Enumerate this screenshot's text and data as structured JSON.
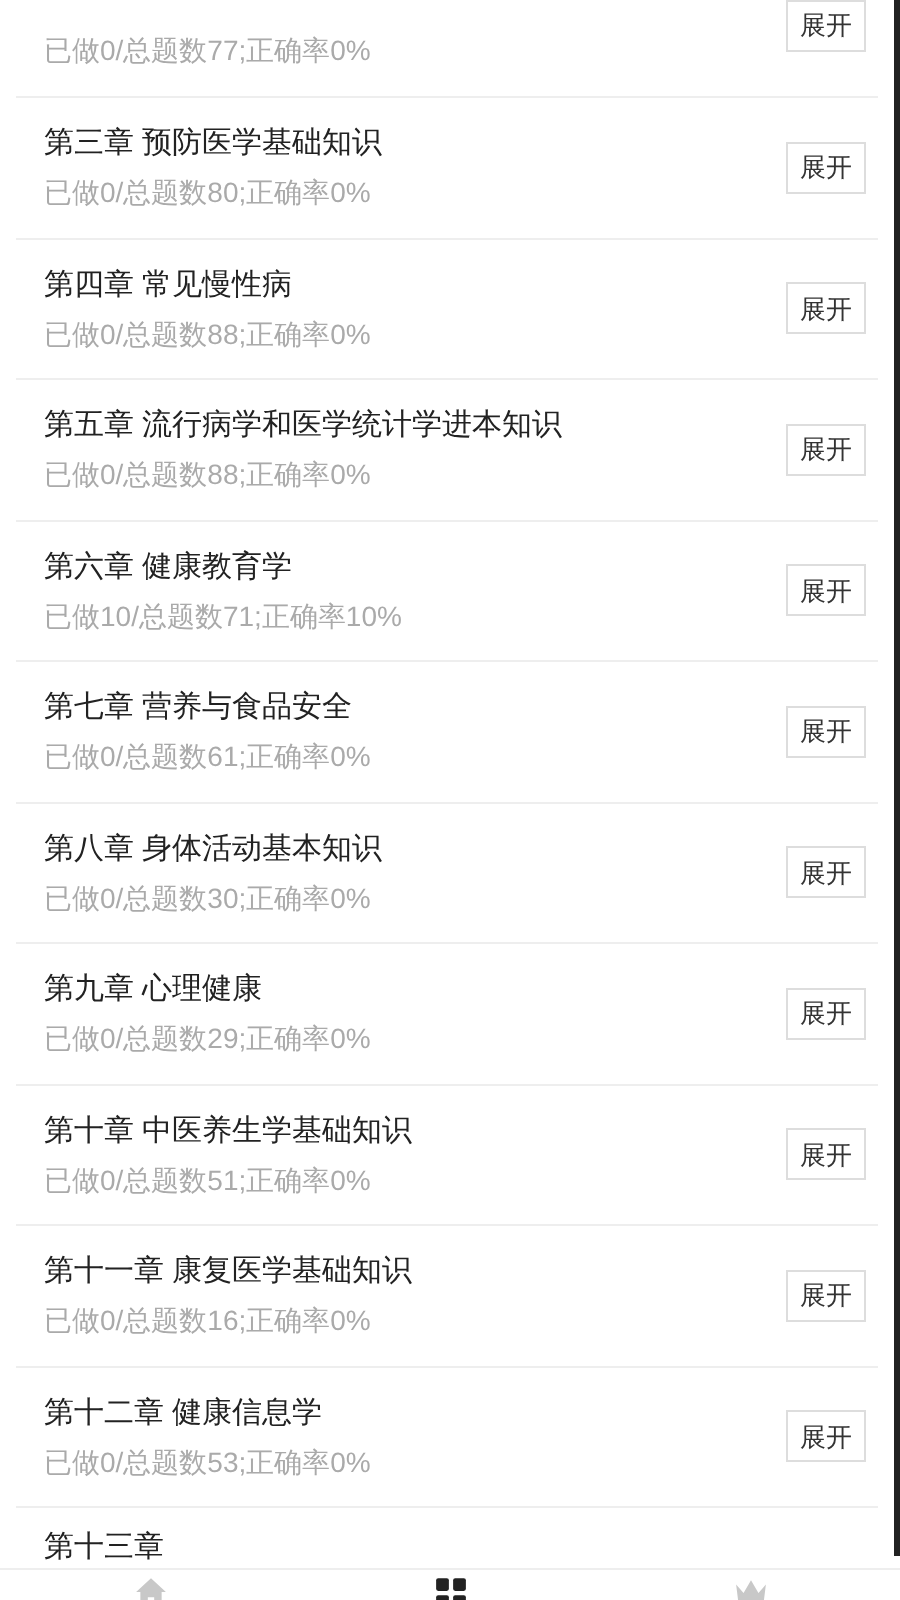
{
  "chapters": [
    {
      "stats": "已做0/总题数77;正确率0%",
      "button": "展开"
    },
    {
      "title": "第三章 预防医学基础知识",
      "stats": "已做0/总题数80;正确率0%",
      "button": "展开"
    },
    {
      "title": "第四章 常见慢性病",
      "stats": "已做0/总题数88;正确率0%",
      "button": "展开"
    },
    {
      "title": "第五章 流行病学和医学统计学进本知识",
      "stats": "已做0/总题数88;正确率0%",
      "button": "展开"
    },
    {
      "title": "第六章 健康教育学",
      "stats": "已做10/总题数71;正确率10%",
      "button": "展开"
    },
    {
      "title": "第七章 营养与食品安全",
      "stats": "已做0/总题数61;正确率0%",
      "button": "展开"
    },
    {
      "title": "第八章 身体活动基本知识",
      "stats": "已做0/总题数30;正确率0%",
      "button": "展开"
    },
    {
      "title": "第九章 心理健康",
      "stats": "已做0/总题数29;正确率0%",
      "button": "展开"
    },
    {
      "title": "第十章 中医养生学基础知识",
      "stats": "已做0/总题数51;正确率0%",
      "button": "展开"
    },
    {
      "title": "第十一章 康复医学基础知识",
      "stats": "已做0/总题数16;正确率0%",
      "button": "展开"
    },
    {
      "title": "第十二章 健康信息学",
      "stats": "已做0/总题数53;正确率0%",
      "button": "展开"
    },
    {
      "title": "第十三章"
    }
  ],
  "tab_bar": [
    {
      "kind": "home",
      "selected": false
    },
    {
      "kind": "grid",
      "selected": true
    },
    {
      "kind": "crown",
      "selected": false
    }
  ]
}
